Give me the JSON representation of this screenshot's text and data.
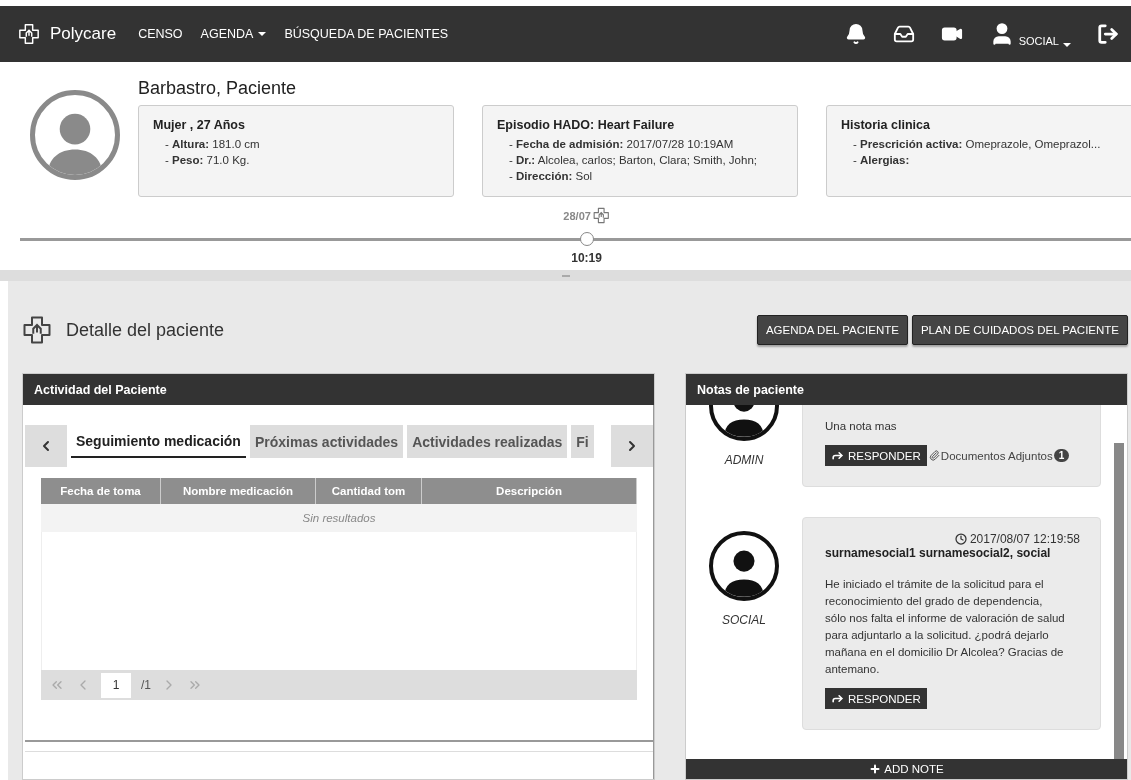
{
  "navbar": {
    "brand": "Polycare",
    "menu": [
      {
        "label": "CENSO",
        "dropdown": false
      },
      {
        "label": "AGENDA",
        "dropdown": true
      },
      {
        "label": "BÚSQUEDA DE PACIENTES",
        "dropdown": false
      }
    ],
    "user": {
      "label": "SOCIAL",
      "dropdown": true
    }
  },
  "patient": {
    "name": "Barbastro, Paciente",
    "cards": [
      {
        "title": "Mujer , 27 Años",
        "items": [
          "- **Altura:** 181.0 cm",
          "- **Peso:** 71.0 Kg."
        ]
      },
      {
        "title": "Episodio HADO: Heart Failure",
        "items": [
          "- **Fecha de admisión:** 2017/07/28 10:19AM",
          "- **Dr.:** Alcolea, carlos; Barton, Clara; Smith, John;",
          "- **Dirección:** Sol"
        ]
      },
      {
        "title": "Historia clinica",
        "items": [
          "- **Prescrición activa:** Omeprazole, Omeprazol...",
          "- **Alergias:**"
        ]
      }
    ]
  },
  "timeline": {
    "date": "28/07",
    "time": "10:19",
    "level": 0.51
  },
  "detail": {
    "title": "Detalle del paciente",
    "buttons": [
      "AGENDA DEL PACIENTE",
      "PLAN DE CUIDADOS DEL PACIENTE"
    ]
  },
  "activity": {
    "title": "Actividad del Paciente",
    "tabs": [
      {
        "label": "Seguimiento medicación",
        "selected": true
      },
      {
        "label": "Próximas actividades",
        "selected": false
      },
      {
        "label": "Actividades realizadas",
        "selected": false
      },
      {
        "label": "Fi",
        "selected": false
      }
    ],
    "table": {
      "columns": [
        "Fecha de toma",
        "Nombre medicación",
        "Cantidad tom",
        "Descripción"
      ],
      "empty": "Sin resultados"
    },
    "pagination": {
      "page": "1",
      "total": "/1"
    }
  },
  "notes": {
    "title": "Notas de paciente",
    "items": [
      {
        "role": "ADMIN",
        "text": "Una nota mas",
        "reply": "RESPONDER",
        "attachments": {
          "label": "Documentos Adjuntos",
          "count": "1"
        }
      },
      {
        "role": "SOCIAL",
        "timestamp": "2017/08/07 12:19:58",
        "author": "surnamesocial1 surnamesocial2, social",
        "text": "He iniciado el trámite de la solicitud para el reconocimiento del grado de dependencia, sólo nos falta el informe de valoración de salud para adjuntarlo a la solicitud. ¿podrá dejarlo mañana en el domicilio Dr Alcolea? Gracias de antemano.",
        "reply": "RESPONDER"
      }
    ],
    "add": "ADD NOTE"
  }
}
